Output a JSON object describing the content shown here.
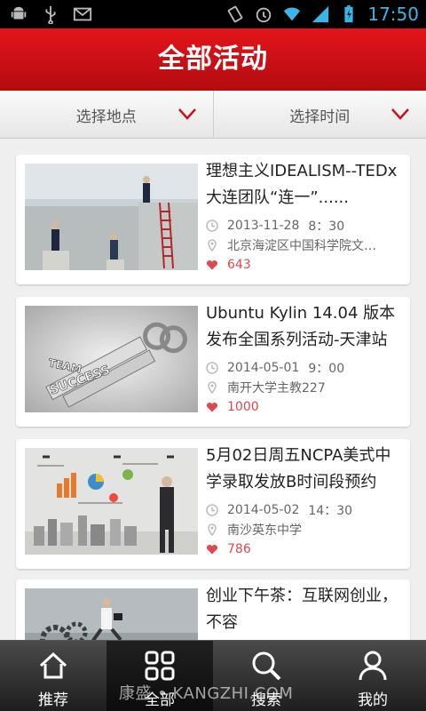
{
  "status_bar": {
    "time": "17:50",
    "left_icons": [
      "android-icon",
      "usb-icon",
      "gmail-icon"
    ],
    "right_icons": [
      "vibrate-icon",
      "alarm-icon",
      "wifi-icon",
      "signal-icon",
      "battery-icon"
    ]
  },
  "header": {
    "title": "全部活动"
  },
  "filters": [
    {
      "label": "选择地点"
    },
    {
      "label": "选择时间"
    }
  ],
  "events": [
    {
      "title": "理想主义IDEALISM--TEDx大连团队“连一”......",
      "date": "2013-11-28",
      "time": "8：30",
      "location": "北京海淀区中国科学院文…",
      "likes": "643",
      "thumb_text": []
    },
    {
      "title": "Ubuntu Kylin 14.04 版本发布全国系列活动-天津站",
      "date": "2014-05-01",
      "time": "9：00",
      "location": "南开大学主教227",
      "likes": "1000",
      "thumb_text": [
        "TEAM",
        "SUCCESS"
      ]
    },
    {
      "title": "5月02日周五NCPA美式中学录取发放B时间段预约",
      "date": "2014-05-02",
      "time": "14：30",
      "location": "南沙英东中学",
      "likes": "786",
      "thumb_text": []
    },
    {
      "title": "创业下午茶：互联网创业，不容",
      "date": "",
      "time": "",
      "location": "",
      "likes": "",
      "thumb_text": []
    }
  ],
  "bottom_nav": [
    {
      "label": "推荐",
      "icon": "home-icon",
      "active": false
    },
    {
      "label": "全部",
      "icon": "grid-icon",
      "active": true
    },
    {
      "label": "搜索",
      "icon": "search-icon",
      "active": false
    },
    {
      "label": "我的",
      "icon": "user-icon",
      "active": false
    }
  ],
  "watermark": "康盛 • KANGZHI.COM",
  "colors": {
    "brand_red": "#d3121a",
    "like_red": "#e0484e",
    "time_blue": "#39b5e8"
  }
}
